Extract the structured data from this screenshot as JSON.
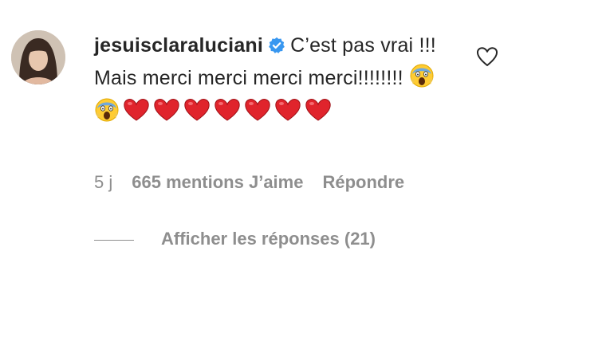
{
  "comment": {
    "username": "jesuisclaraluciani",
    "verified_icon": "verified-badge-icon",
    "text": "C’est pas vrai !!! Mais merci merci merci merci!!!!!!!!",
    "emojis": [
      "scream-emoji",
      "scream-emoji",
      "red-heart-emoji",
      "red-heart-emoji",
      "red-heart-emoji",
      "red-heart-emoji",
      "red-heart-emoji",
      "red-heart-emoji",
      "red-heart-emoji"
    ],
    "time": "5 j",
    "likes": "665 mentions J’aime",
    "reply_label": "Répondre",
    "view_replies": "Afficher les réponses (21)",
    "like_icon": "heart-outline-icon"
  },
  "colors": {
    "text": "#262626",
    "secondary": "#8e8e8e",
    "verified": "#3897f0",
    "heart": "#e0242c"
  }
}
